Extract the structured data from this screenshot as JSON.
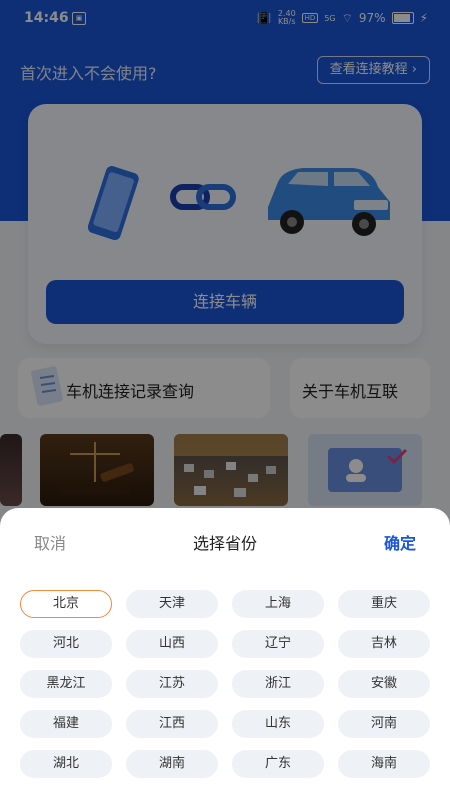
{
  "status_bar": {
    "time": "14:46",
    "speed_top": "2.40",
    "speed_bottom": "KB/s",
    "hd": "HD",
    "network": "5G",
    "battery": "97%"
  },
  "home": {
    "help_text": "首次进入不会使用?",
    "tutorial_button": "查看连接教程",
    "connect_button": "连接车辆",
    "feature_records": "车机连接记录查询",
    "feature_about": "关于车机互联"
  },
  "sheet": {
    "cancel": "取消",
    "title": "选择省份",
    "confirm": "确定",
    "selected_province": "北京",
    "provinces": [
      "北京",
      "天津",
      "上海",
      "重庆",
      "河北",
      "山西",
      "辽宁",
      "吉林",
      "黑龙江",
      "江苏",
      "浙江",
      "安徽",
      "福建",
      "江西",
      "山东",
      "河南",
      "湖北",
      "湖南",
      "广东",
      "海南"
    ]
  },
  "colors": {
    "accent": "#1a56d8",
    "selected_border": "#f08a3c"
  }
}
